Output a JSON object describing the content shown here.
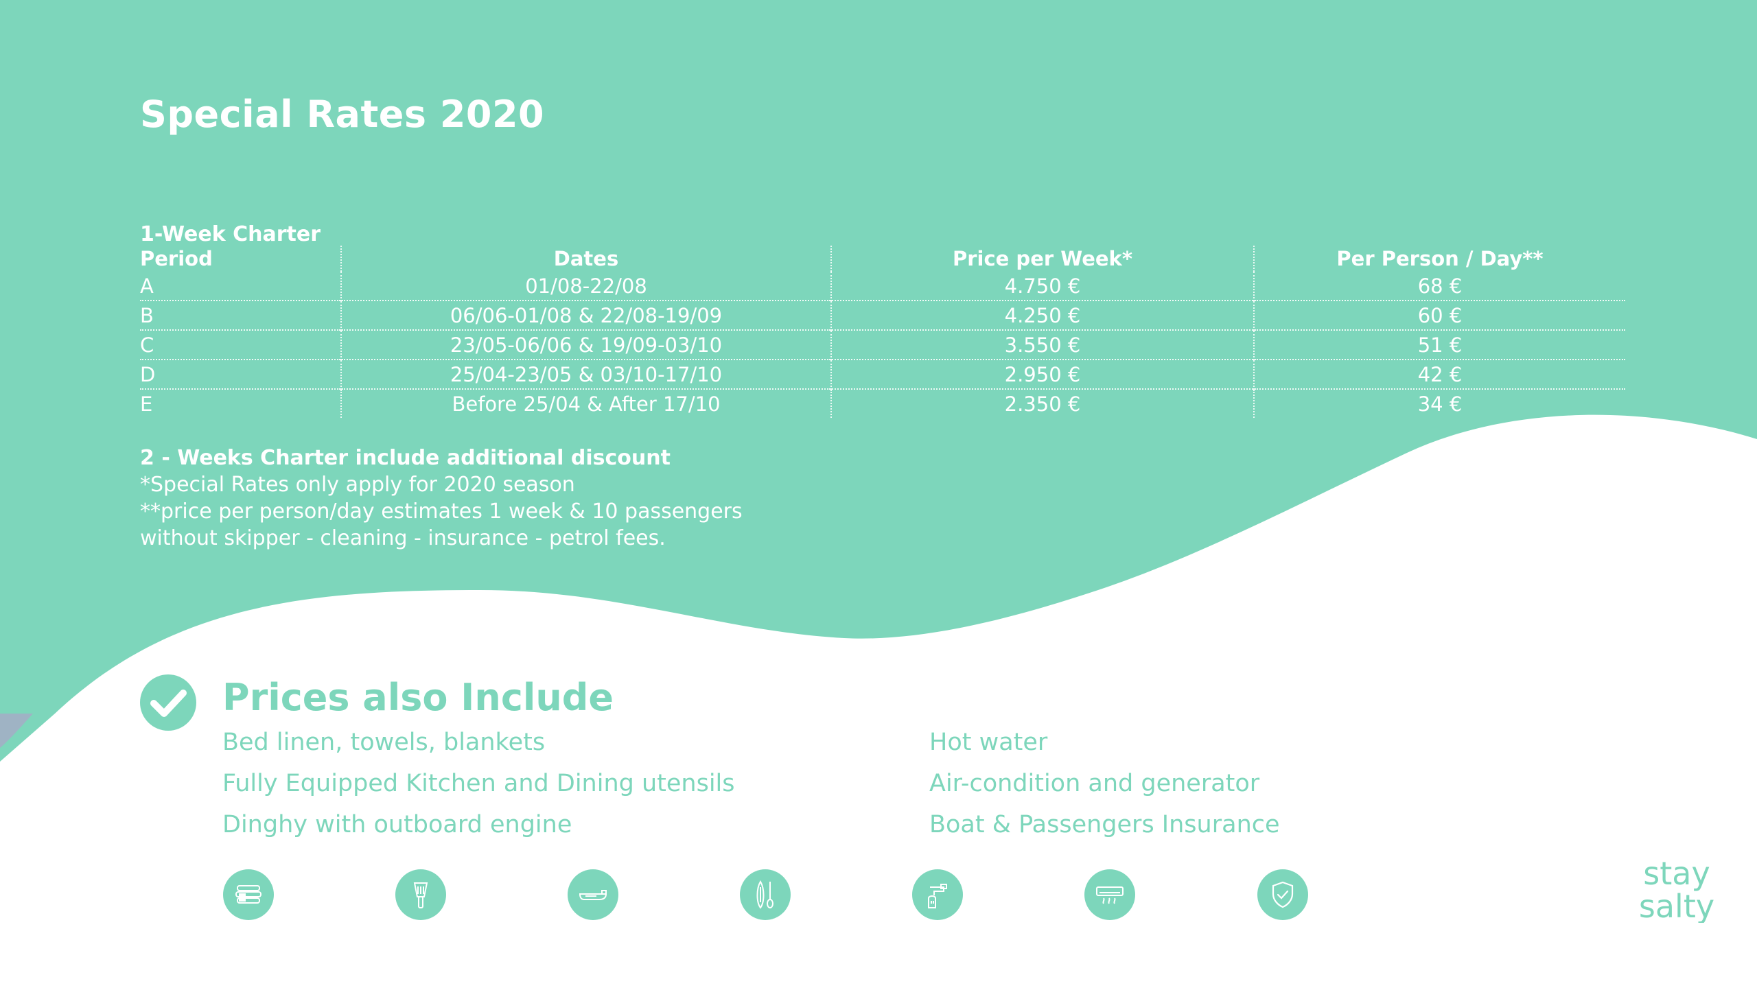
{
  "colors": {
    "mint": "#7dd6bb",
    "white": "#ffffff",
    "slate": "#9fb3c4"
  },
  "title": "Special Rates 2020",
  "table": {
    "subheading": "1-Week Charter",
    "headers": [
      "Period",
      "Dates",
      "Price per Week*",
      "Per Person / Day**"
    ],
    "rows": [
      [
        "A",
        "01/08-22/08",
        "4.750 €",
        "68 €"
      ],
      [
        "B",
        "06/06-01/08 & 22/08-19/09",
        "4.250 €",
        "60 €"
      ],
      [
        "C",
        "23/05-06/06 & 19/09-03/10",
        "3.550 €",
        "51 €"
      ],
      [
        "D",
        "25/04-23/05 & 03/10-17/10",
        "2.950 €",
        "42 €"
      ],
      [
        "E",
        "Before 25/04 & After 17/10",
        "2.350 €",
        "34 €"
      ]
    ]
  },
  "notes": {
    "discount": "2 - Weeks Charter include additional discount",
    "line1": "*Special Rates only apply for 2020 season",
    "line2": "**price per person/day estimates 1 week & 10 passengers",
    "line3": "without skipper  - cleaning - insurance - petrol fees."
  },
  "include": {
    "title": "Prices  also Include",
    "left": [
      "Bed linen, towels, blankets",
      "Fully Equipped Kitchen and Dining utensils",
      "Dinghy with outboard engine"
    ],
    "right": [
      "Hot water",
      "Air-condition and generator",
      "Boat & Passengers Insurance"
    ]
  },
  "icons": [
    "linen-icon",
    "kitchen-icon",
    "dinghy-icon",
    "paddle-board-icon",
    "hot-water-icon",
    "air-condition-icon",
    "insurance-shield-icon"
  ],
  "logo": {
    "line1": "stay",
    "line2": "salty"
  }
}
